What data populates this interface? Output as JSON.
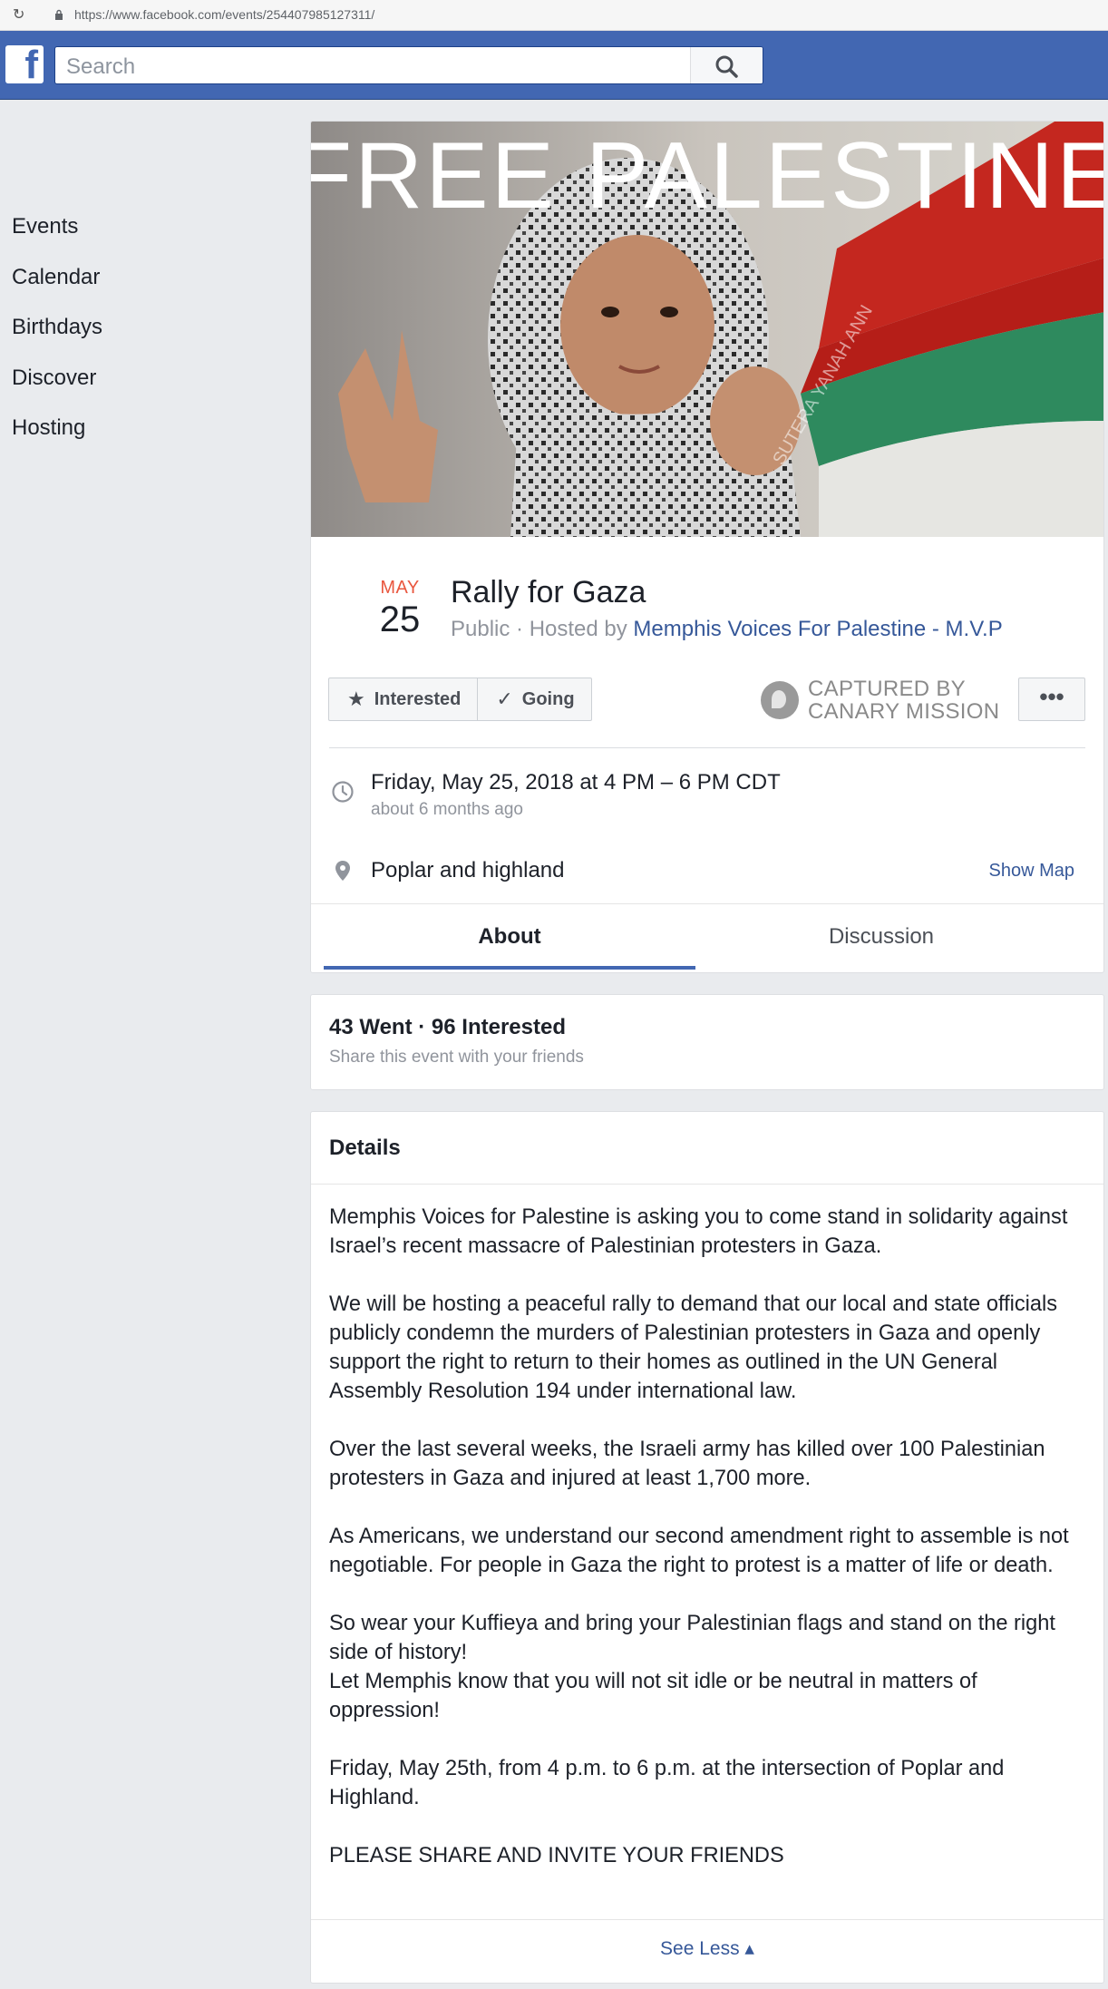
{
  "browser": {
    "url": "https://www.facebook.com/events/254407985127311/"
  },
  "header": {
    "logo": "f",
    "search_placeholder": "Search"
  },
  "sidebar": {
    "items": [
      {
        "label": "Events"
      },
      {
        "label": "Calendar"
      },
      {
        "label": "Birthdays"
      },
      {
        "label": "Discover"
      },
      {
        "label": "Hosting"
      }
    ]
  },
  "event": {
    "cover_text": "FREE PALESTINE",
    "cover_watermark": "SUTERA YANAH ANN",
    "month": "MAY",
    "day": "25",
    "title": "Rally for Gaza",
    "privacy_prefix": "Public · Hosted by ",
    "host": "Memphis Voices For Palestine - M.V.P",
    "interested_label": "Interested",
    "going_label": "Going",
    "stamp_line1": "CAPTURED BY",
    "stamp_line2": "CANARY MISSION",
    "more_label": "•••",
    "datetime": "Friday, May 25, 2018 at 4 PM – 6 PM CDT",
    "relative_time": "about 6 months ago",
    "location": "Poplar and highland",
    "show_map": "Show Map",
    "tabs": [
      {
        "label": "About"
      },
      {
        "label": "Discussion"
      }
    ]
  },
  "stats": {
    "summary": "43 Went · 96 Interested",
    "share_hint": "Share this event with your friends"
  },
  "details": {
    "heading": "Details",
    "paragraphs": [
      "Memphis Voices for Palestine is asking you to come stand in solidarity against Israel’s recent massacre of Palestinian protesters in Gaza.",
      "We will be hosting a peaceful rally to demand that our local and state officials publicly condemn the murders of Palestinian protesters in Gaza and openly support the right to return to their homes as outlined in the UN General Assembly Resolution 194 under international law.",
      "Over the last several weeks, the Israeli army has killed over 100 Palestinian protesters in Gaza and injured at least 1,700 more.",
      "As Americans, we understand our second amendment right to assemble is not negotiable. For people in Gaza the right to protest is a matter of life or death.",
      "So wear your Kuffieya and bring your Palestinian flags and stand on the right side of history!",
      "Let Memphis know that you will not sit idle or be neutral in matters of oppression!",
      "Friday, May 25th, from 4 p.m. to 6 p.m. at the intersection of Poplar and Highland.",
      "PLEASE SHARE AND INVITE YOUR FRIENDS"
    ],
    "see_less": "See Less ▴"
  },
  "colors": {
    "fb_blue": "#4267b2",
    "link": "#365899",
    "month_red": "#e9573f",
    "page_bg": "#e9ebee"
  }
}
